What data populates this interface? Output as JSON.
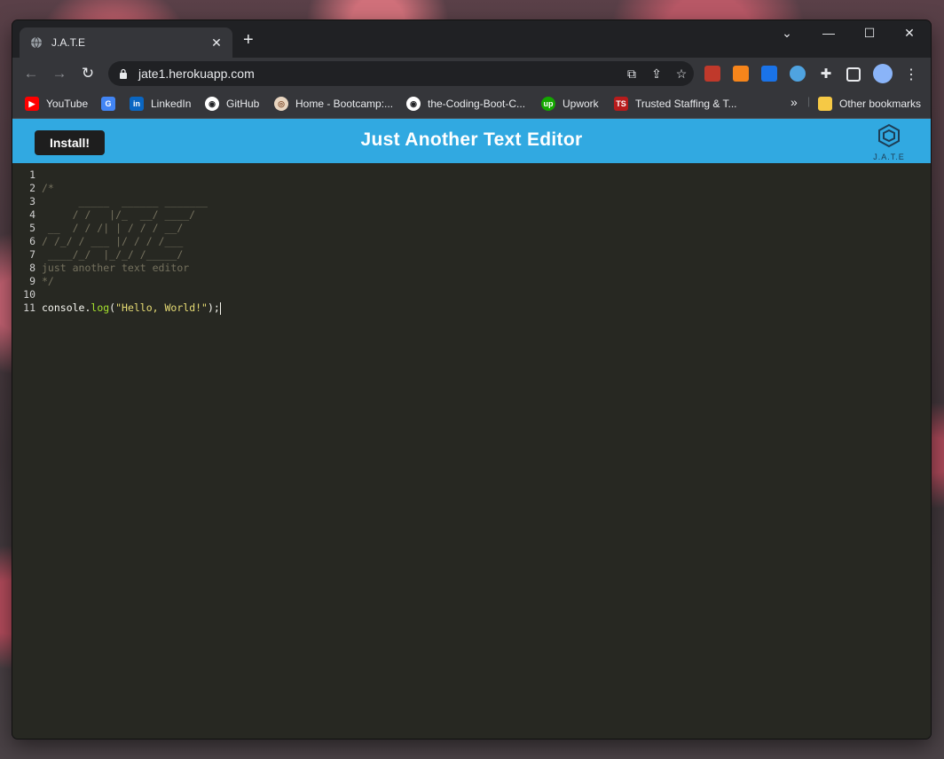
{
  "browser": {
    "tab_title": "J.A.T.E",
    "url": "jate1.herokuapp.com",
    "window_controls": [
      "chevron-down-icon",
      "minimize-icon",
      "maximize-icon",
      "close-icon"
    ]
  },
  "bookmarks": [
    {
      "label": "YouTube",
      "icon": "youtube-icon",
      "color": "#ff0000"
    },
    {
      "label": "",
      "icon": "translate-icon",
      "color": "#4285f4"
    },
    {
      "label": "LinkedIn",
      "icon": "linkedin-icon",
      "color": "#0a66c2"
    },
    {
      "label": "GitHub",
      "icon": "github-icon",
      "color": "#ffffff"
    },
    {
      "label": "Home - Bootcamp:...",
      "icon": "bootcamp-icon",
      "color": "#e8d5c0"
    },
    {
      "label": "the-Coding-Boot-C...",
      "icon": "github-icon",
      "color": "#ffffff"
    },
    {
      "label": "Upwork",
      "icon": "upwork-icon",
      "color": "#14a800"
    },
    {
      "label": "Trusted Staffing & T...",
      "icon": "staffing-icon",
      "color": "#b71c1c"
    }
  ],
  "bookmarks_more": "»",
  "other_bookmarks": "Other bookmarks",
  "app": {
    "install_label": "Install!",
    "title": "Just Another Text Editor",
    "logo_text": "J.A.T.E",
    "accent": "#31a9e1"
  },
  "editor": {
    "lines": [
      {
        "n": "1",
        "text": ""
      },
      {
        "n": "2",
        "text": "/*"
      },
      {
        "n": "3",
        "text": "      _____  ______ _______"
      },
      {
        "n": "4",
        "text": "     / /   |/_  __/ ____/"
      },
      {
        "n": "5",
        "text": " __  / / /| | / / / __/"
      },
      {
        "n": "6",
        "text": "/ /_/ / ___ |/ / / /___"
      },
      {
        "n": "7",
        "text": " ____/_/  |_/_/ /_____/"
      },
      {
        "n": "8",
        "text": "just another text editor"
      },
      {
        "n": "9",
        "text": "*/"
      },
      {
        "n": "10",
        "text": ""
      }
    ],
    "code_line": {
      "n": "11",
      "obj": "console.",
      "fn": "log",
      "open": "(",
      "str": "\"Hello, World!\"",
      "close": ");"
    }
  }
}
